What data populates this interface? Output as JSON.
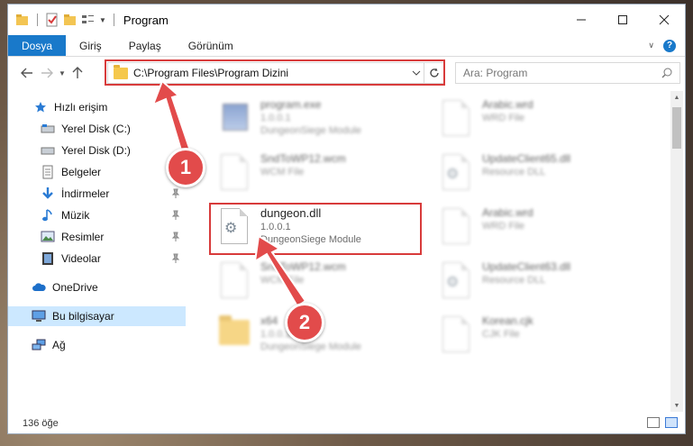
{
  "window": {
    "title": "Program"
  },
  "ribbon": {
    "tabs": [
      {
        "label": "Dosya",
        "active": true
      },
      {
        "label": "Giriş",
        "active": false
      },
      {
        "label": "Paylaş",
        "active": false
      },
      {
        "label": "Görünüm",
        "active": false
      }
    ],
    "help_label": "?"
  },
  "nav": {
    "address": "C:\\Program Files\\Program Dizini",
    "search_placeholder": "Ara: Program"
  },
  "sidebar": {
    "items": [
      {
        "label": "Hızlı erişim",
        "icon": "star-icon",
        "pinned": false
      },
      {
        "label": "Yerel Disk (C:)",
        "icon": "drive-icon",
        "pinned": false
      },
      {
        "label": "Yerel Disk (D:)",
        "icon": "drive-icon",
        "pinned": false
      },
      {
        "label": "Belgeler",
        "icon": "documents-icon",
        "pinned": false
      },
      {
        "label": "İndirmeler",
        "icon": "download-icon",
        "pinned": true
      },
      {
        "label": "Müzik",
        "icon": "music-icon",
        "pinned": true
      },
      {
        "label": "Resimler",
        "icon": "pictures-icon",
        "pinned": true
      },
      {
        "label": "Videolar",
        "icon": "videos-icon",
        "pinned": true
      },
      {
        "label": "OneDrive",
        "icon": "cloud-icon",
        "pinned": false
      },
      {
        "label": "Bu bilgisayar",
        "icon": "computer-icon",
        "pinned": false,
        "selected": true
      },
      {
        "label": "Ağ",
        "icon": "network-icon",
        "pinned": false
      }
    ]
  },
  "files": [
    {
      "name": "program.exe",
      "line2": "1.0.0.1",
      "line3": "DungeonSiege Module",
      "kind": "exe",
      "blurred": true
    },
    {
      "name": "Arabic.wrd",
      "line2": "WRD File",
      "line3": "",
      "kind": "doc",
      "blurred": true
    },
    {
      "name": "SndToWP12.wcm",
      "line2": "WCM File",
      "line3": "",
      "kind": "doc",
      "blurred": true
    },
    {
      "name": "UpdateClient65.dll",
      "line2": "Resource DLL",
      "line3": "",
      "kind": "dll",
      "blurred": true
    },
    {
      "name": "dungeon.dll",
      "line2": "1.0.0.1",
      "line3": "DungeonSiege Module",
      "kind": "dll",
      "blurred": false
    },
    {
      "name": "Arabic.wrd",
      "line2": "WRD File",
      "line3": "",
      "kind": "doc",
      "blurred": true
    },
    {
      "name": "SndToWP12.wcm",
      "line2": "WCM File",
      "line3": "",
      "kind": "doc",
      "blurred": true
    },
    {
      "name": "UpdateClient63.dll",
      "line2": "Resource DLL",
      "line3": "",
      "kind": "dll",
      "blurred": true
    },
    {
      "name": "x64",
      "line2": "1.0.0.1",
      "line3": "DungeonSiege Module",
      "kind": "folder",
      "blurred": true
    },
    {
      "name": "Korean.cjk",
      "line2": "CJK File",
      "line3": "",
      "kind": "doc",
      "blurred": true
    }
  ],
  "status": {
    "item_count": "136 öğe"
  },
  "annotations": {
    "badge1": "1",
    "badge2": "2",
    "color": "#e24b4b"
  }
}
